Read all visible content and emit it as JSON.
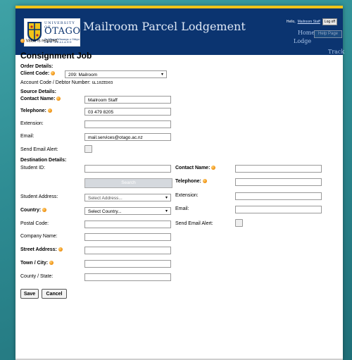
{
  "header": {
    "university_label": "UNIVERSITY OF",
    "university_name": "OTAGO",
    "maori_name": "Te Whare Wānanga o Otāgo",
    "country": "NEW ZEALAND",
    "app_title": "Mailroom Parcel Lodgement",
    "user_greeting": "Hello,",
    "user_name": "Mailroom Staff",
    "logoff_label": "Log off",
    "nav": {
      "home": "Home",
      "help": "Help Page",
      "lodge": "Lodge",
      "track": "Track"
    }
  },
  "form": {
    "required_note": "Value is required.",
    "title": "Consignment Job",
    "order": {
      "heading": "Order Details:",
      "client_code_label": "Client Code:",
      "client_code_value": "209: Mailroom",
      "account_label": "Account Code / Debtor Number:",
      "account_value": "GL10ZED03"
    },
    "source": {
      "heading": "Source Details:",
      "contact_name_label": "Contact Name:",
      "contact_name_value": "Mailroom Staff",
      "telephone_label": "Telephone:",
      "telephone_value": "03 479 8205",
      "extension_label": "Extension:",
      "extension_value": "",
      "email_label": "Email:",
      "email_value": "mail.services@otago.ac.nz",
      "alert_label": "Send Email Alert:"
    },
    "destination": {
      "heading": "Destination Details:",
      "student_id_label": "Student ID:",
      "student_id_value": "",
      "search_label": "Search",
      "student_address_label": "Student Address:",
      "student_address_value": "Select Address...",
      "country_label": "Country:",
      "country_value": "Select Country...",
      "postal_code_label": "Postal Code:",
      "company_label": "Company Name:",
      "street_label": "Street Address:",
      "town_label": "Town / City:",
      "county_label": "County / State:",
      "contact_name_label": "Contact Name:",
      "telephone_label": "Telephone:",
      "extension_label": "Extension:",
      "email_label": "Email:",
      "alert_label": "Send Email Alert:"
    },
    "buttons": {
      "save": "Save",
      "cancel": "Cancel"
    }
  },
  "colors": {
    "header_bg": "#0b3470",
    "accent_gold": "#f0c419",
    "required_dot": "#f29a1d",
    "page_bg": "#2e8c93"
  }
}
